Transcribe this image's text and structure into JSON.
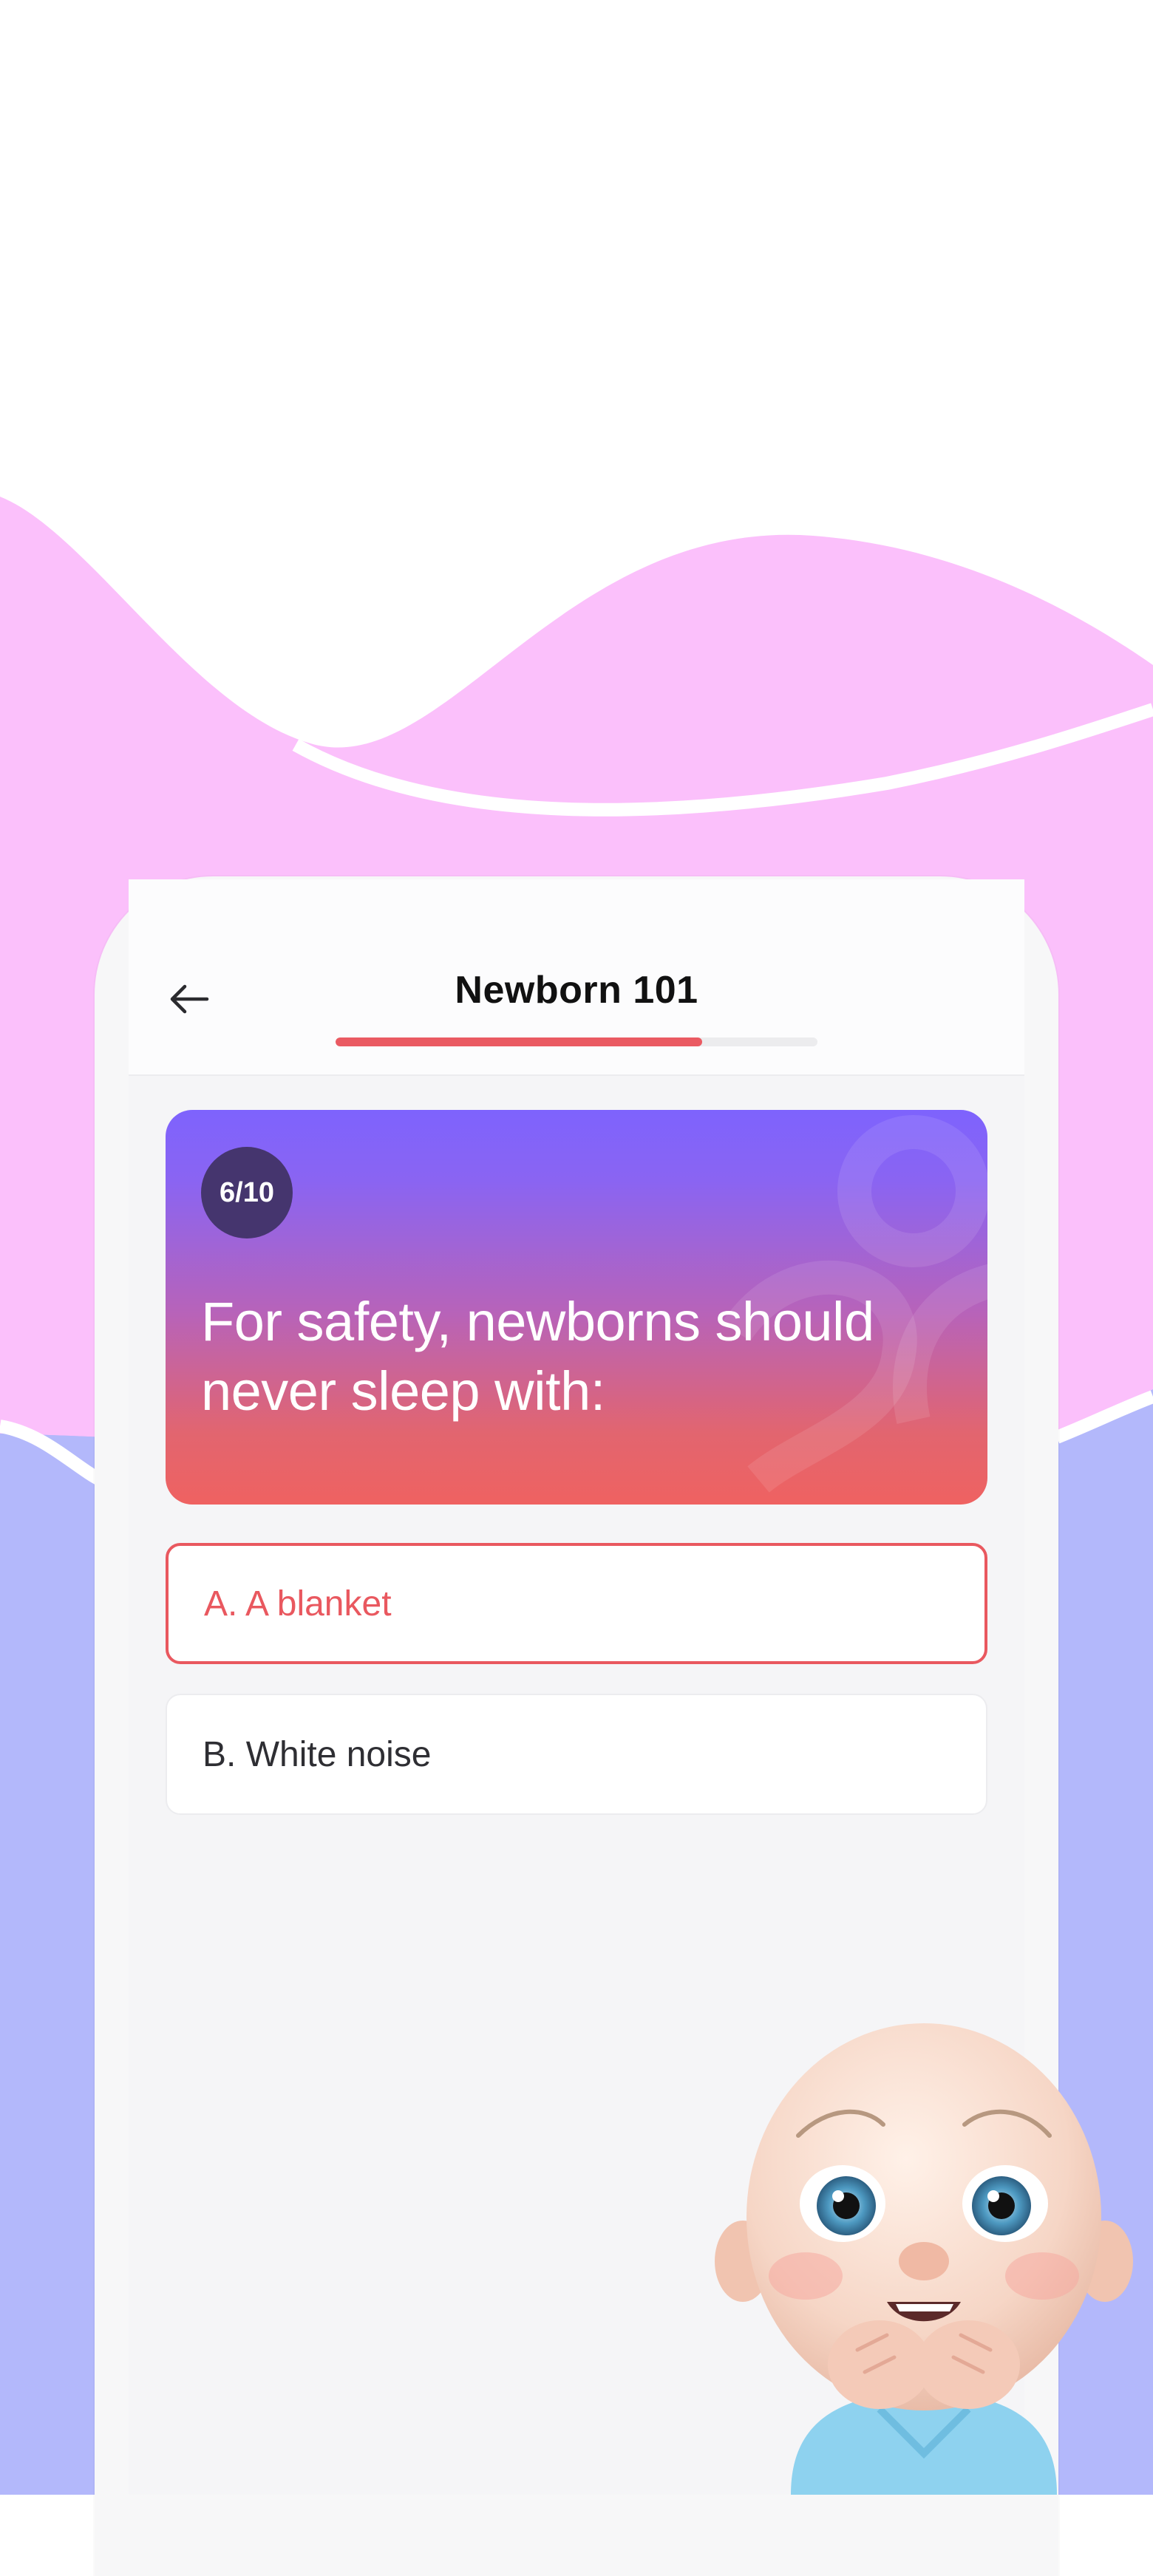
{
  "header": {
    "title": "Newborn 101",
    "progress_fraction": 0.76
  },
  "question_card": {
    "counter": "6/10",
    "question": "For safety, newborns should never sleep with:"
  },
  "options": [
    {
      "label": "A. A blanket",
      "state": "selected"
    },
    {
      "label": "B. White noise",
      "state": "default"
    }
  ],
  "colors": {
    "accent": "#ea5a62",
    "pink_wave": "#fbc0fb",
    "lavender_bg": "#b3b8fb",
    "card_gradient_top": "#7e63fd",
    "card_gradient_bottom": "#ef6261",
    "counter_badge": "#45356e"
  },
  "icons": {
    "back": "arrow-left-icon",
    "mascot": "baby-mascot-illustration"
  }
}
